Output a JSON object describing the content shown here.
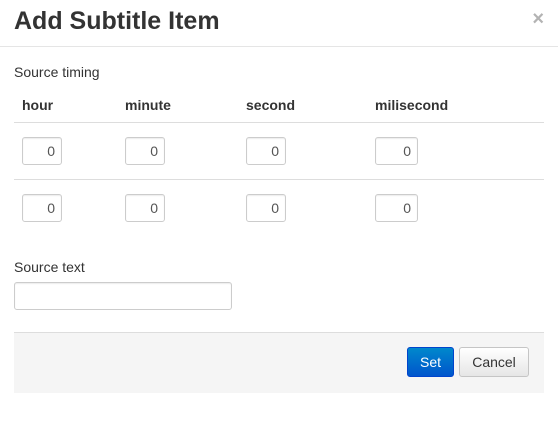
{
  "dialog": {
    "title": "Add Subtitle Item",
    "close_glyph": "×"
  },
  "source_timing": {
    "label": "Source timing",
    "columns": [
      "hour",
      "minute",
      "second",
      "milisecond"
    ],
    "rows": [
      [
        "0",
        "0",
        "0",
        "0"
      ],
      [
        "0",
        "0",
        "0",
        "0"
      ]
    ]
  },
  "source_text": {
    "label": "Source text",
    "value": ""
  },
  "footer": {
    "set_label": "Set",
    "cancel_label": "Cancel"
  },
  "colors": {
    "primary": "#0066cc",
    "footer_bg": "#f5f5f5"
  }
}
